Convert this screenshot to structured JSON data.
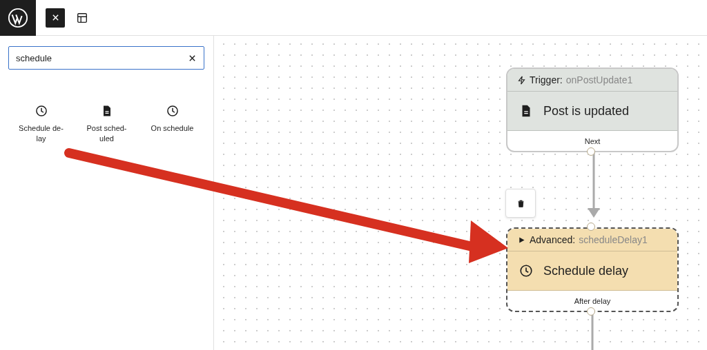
{
  "search": {
    "value": "schedule"
  },
  "results": [
    {
      "label": "Schedule de-lay",
      "kind": "clock"
    },
    {
      "label": "Post sched-uled",
      "kind": "post"
    },
    {
      "label": "On schedule",
      "kind": "clock"
    }
  ],
  "nodes": [
    {
      "kind": "trigger",
      "type_label": "Trigger:",
      "id": "onPostUpdate1",
      "title": "Post is updated",
      "footer": "Next",
      "selected": false
    },
    {
      "kind": "advanced",
      "type_label": "Advanced:",
      "id": "scheduleDelay1",
      "title": "Schedule delay",
      "footer": "After delay",
      "selected": true
    }
  ]
}
